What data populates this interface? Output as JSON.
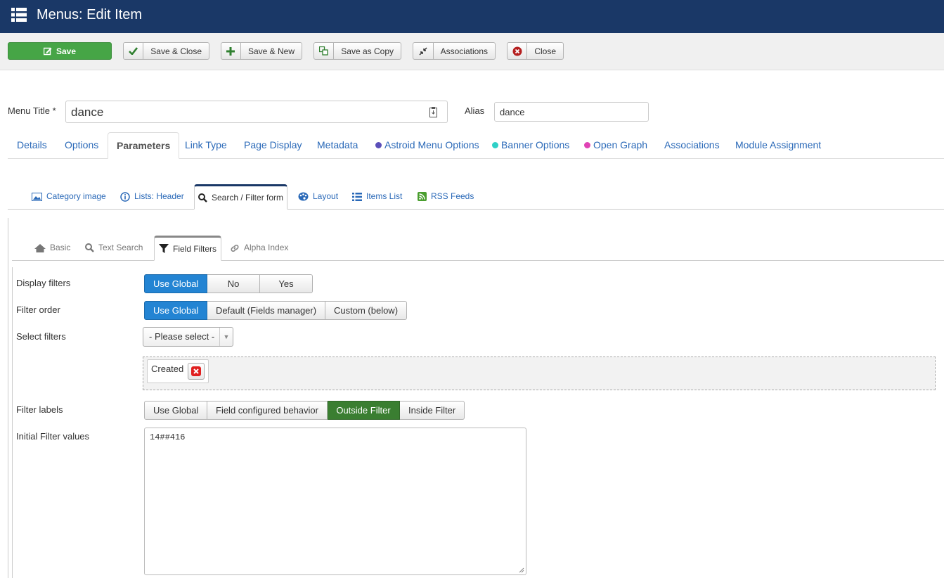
{
  "header": {
    "title": "Menus: Edit Item",
    "icon": "list-icon",
    "bg_color": "#1a3867"
  },
  "toolbar": {
    "save": "Save",
    "save_close": "Save & Close",
    "save_new": "Save & New",
    "save_copy": "Save as Copy",
    "associations": "Associations",
    "close": "Close"
  },
  "form": {
    "menu_title_label": "Menu Title *",
    "menu_title_value": "dance",
    "alias_label": "Alias",
    "alias_value": "dance"
  },
  "main_tabs": [
    {
      "label": "Details"
    },
    {
      "label": "Options"
    },
    {
      "label": "Parameters",
      "active": true
    },
    {
      "label": "Link Type"
    },
    {
      "label": "Page Display"
    },
    {
      "label": "Metadata"
    },
    {
      "label": "Astroid Menu Options",
      "dot": "#5b4fb9"
    },
    {
      "label": "Banner Options",
      "dot": "#2fd0c7"
    },
    {
      "label": "Open Graph",
      "dot": "#e043b5"
    },
    {
      "label": "Associations"
    },
    {
      "label": "Module Assignment"
    }
  ],
  "sub_tabs": [
    {
      "label": "Category image",
      "icon": "image-icon"
    },
    {
      "label": "Lists: Header",
      "icon": "info-icon"
    },
    {
      "label": "Search / Filter form",
      "icon": "search-icon",
      "active": true
    },
    {
      "label": "Layout",
      "icon": "palette-icon"
    },
    {
      "label": "Items List",
      "icon": "list-icon"
    },
    {
      "label": "RSS Feeds",
      "icon": "rss-icon"
    }
  ],
  "third_tabs": [
    {
      "label": "Basic",
      "icon": "home-icon"
    },
    {
      "label": "Text Search",
      "icon": "search-icon"
    },
    {
      "label": "Field Filters",
      "icon": "filter-icon",
      "active": true
    },
    {
      "label": "Alpha Index",
      "icon": "link-icon"
    }
  ],
  "fields": {
    "display_filters": {
      "label": "Display filters",
      "options": [
        "Use Global",
        "No",
        "Yes"
      ],
      "selected": "Use Global"
    },
    "filter_order": {
      "label": "Filter order",
      "options": [
        "Use Global",
        "Default (Fields manager)",
        "Custom (below)"
      ],
      "selected": "Use Global"
    },
    "select_filters": {
      "label": "Select filters",
      "placeholder": "- Please select -",
      "chips": [
        "Created"
      ]
    },
    "filter_labels": {
      "label": "Filter labels",
      "options": [
        "Use Global",
        "Field configured behavior",
        "Outside Filter",
        "Inside Filter"
      ],
      "selected": "Outside Filter"
    },
    "initial_values": {
      "label": "Initial Filter values",
      "value": "14##416"
    }
  }
}
